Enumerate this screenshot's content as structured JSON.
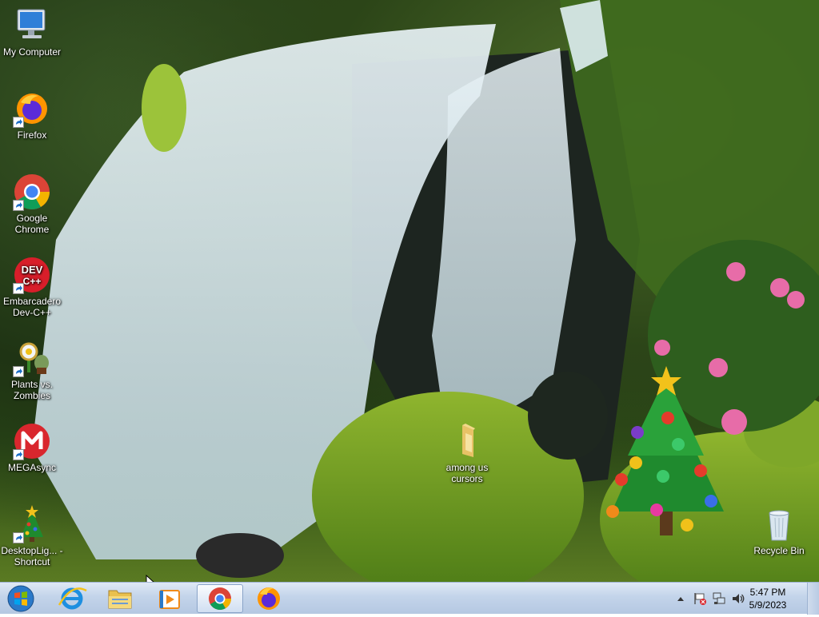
{
  "desktop": {
    "icons": [
      {
        "label": "My Computer",
        "icon": "computer-icon"
      },
      {
        "label": "Firefox",
        "icon": "firefox-icon"
      },
      {
        "label": "Google Chrome",
        "icon": "chrome-icon"
      },
      {
        "label": "Embarcadero Dev-C++",
        "icon": "devcpp-icon"
      },
      {
        "label": "Plants vs. Zombies",
        "icon": "plants-vs-zombies-icon"
      },
      {
        "label": "MEGAsync",
        "icon": "mega-icon"
      },
      {
        "label": "DesktopLig... - Shortcut",
        "icon": "christmas-tree-icon"
      },
      {
        "label": "among us cursors",
        "icon": "folder-icon"
      },
      {
        "label": "Recycle Bin",
        "icon": "recycle-bin-icon"
      }
    ]
  },
  "taskbar": {
    "start": "windows-start-icon",
    "pinned": [
      "internet-explorer-icon",
      "file-explorer-icon",
      "media-player-icon",
      "chrome-icon",
      "firefox-icon"
    ],
    "active_app": "chrome-icon",
    "clock": {
      "time": "5:47 PM",
      "date": "5/9/2023"
    },
    "tray": [
      "show-hidden-icons",
      "action-center-flag-icon",
      "network-icon",
      "volume-icon"
    ]
  },
  "colors": {
    "taskbar": "#c3d4ea",
    "accent": "#1e6fc7"
  }
}
